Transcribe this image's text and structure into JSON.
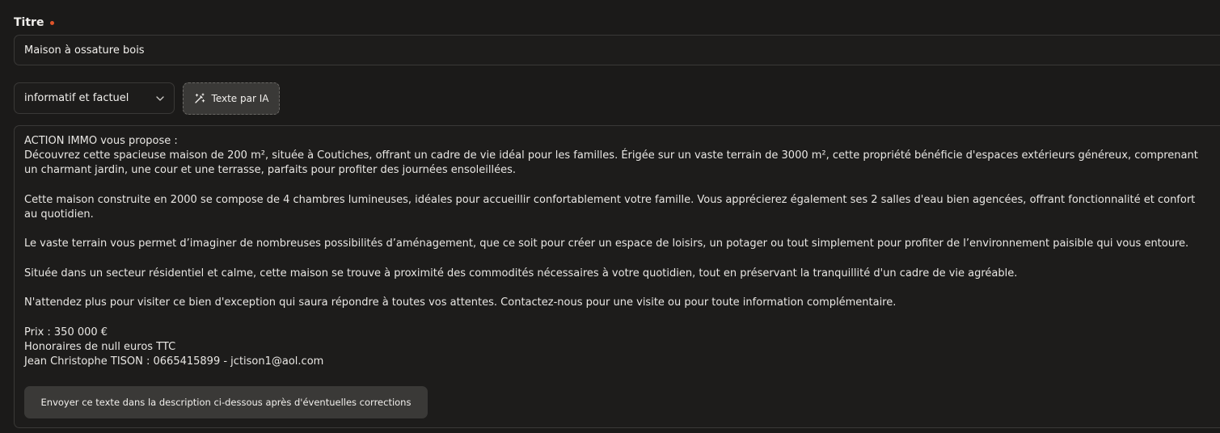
{
  "title_field": {
    "label": "Titre",
    "value": "Maison à ossature bois",
    "required_color": "#e0542a"
  },
  "tone_select": {
    "selected": "informatif et factuel",
    "icon": "chevron-down-icon"
  },
  "ai_button": {
    "label": "Texte par IA",
    "icon": "magic-wand-icon"
  },
  "generated": {
    "text": "ACTION IMMO vous propose :\nDécouvrez cette spacieuse maison de 200 m², située à Coutiches, offrant un cadre de vie idéal pour les familles. Érigée sur un vaste terrain de 3000 m², cette propriété bénéficie d'espaces extérieurs généreux, comprenant un charmant jardin, une cour et une terrasse, parfaits pour profiter des journées ensoleillées.\n\nCette maison construite en 2000 se compose de 4 chambres lumineuses, idéales pour accueillir confortablement votre famille. Vous apprécierez également ses 2 salles d'eau bien agencées, offrant fonctionnalité et confort au quotidien.\n\nLe vaste terrain vous permet d’imaginer de nombreuses possibilités d’aménagement, que ce soit pour créer un espace de loisirs, un potager ou tout simplement pour profiter de l’environnement paisible qui vous entoure.\n\nSituée dans un secteur résidentiel et calme, cette maison se trouve à proximité des commodités nécessaires à votre quotidien, tout en préservant la tranquillité d'un cadre de vie agréable.\n\nN'attendez plus pour visiter ce bien d'exception qui saura répondre à toutes vos attentes. Contactez-nous pour une visite ou pour toute information complémentaire.\n\nPrix : 350 000 €\nHonoraires de null euros TTC\nJean Christophe TISON : 0665415899 - jctison1@aol.com"
  },
  "send_button": {
    "label": "Envoyer ce texte dans la description ci-dessous après d'éventuelles corrections"
  }
}
